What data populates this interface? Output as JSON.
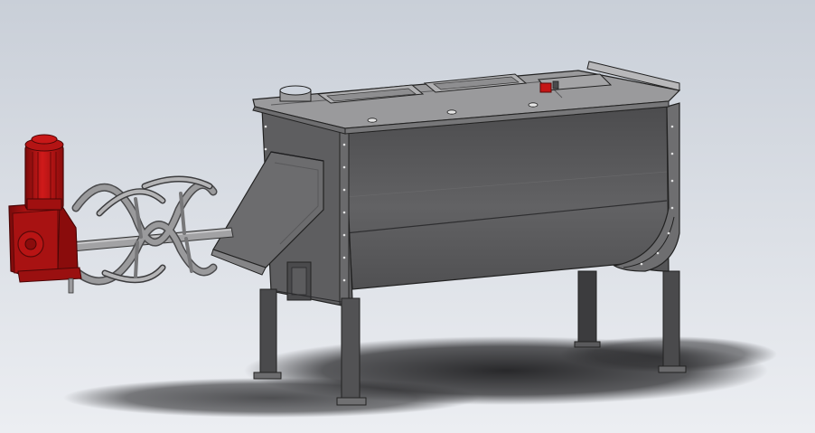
{
  "viewport": {
    "background_top": "#c9cfd8",
    "background_bottom": "#eceef2"
  },
  "model": {
    "trough_body": "#5a5a5c",
    "trough_shadow": "#3e3e40",
    "trough_highlight": "#7b7b7e",
    "lid": "#9a9a9c",
    "steel_light": "#b8b8ba",
    "edge": "#222222",
    "motor": "#c41616",
    "motor_dark": "#7a0a0a",
    "ribbon": "#8c8c8e",
    "floor_shadow": "#2a2a2c"
  }
}
